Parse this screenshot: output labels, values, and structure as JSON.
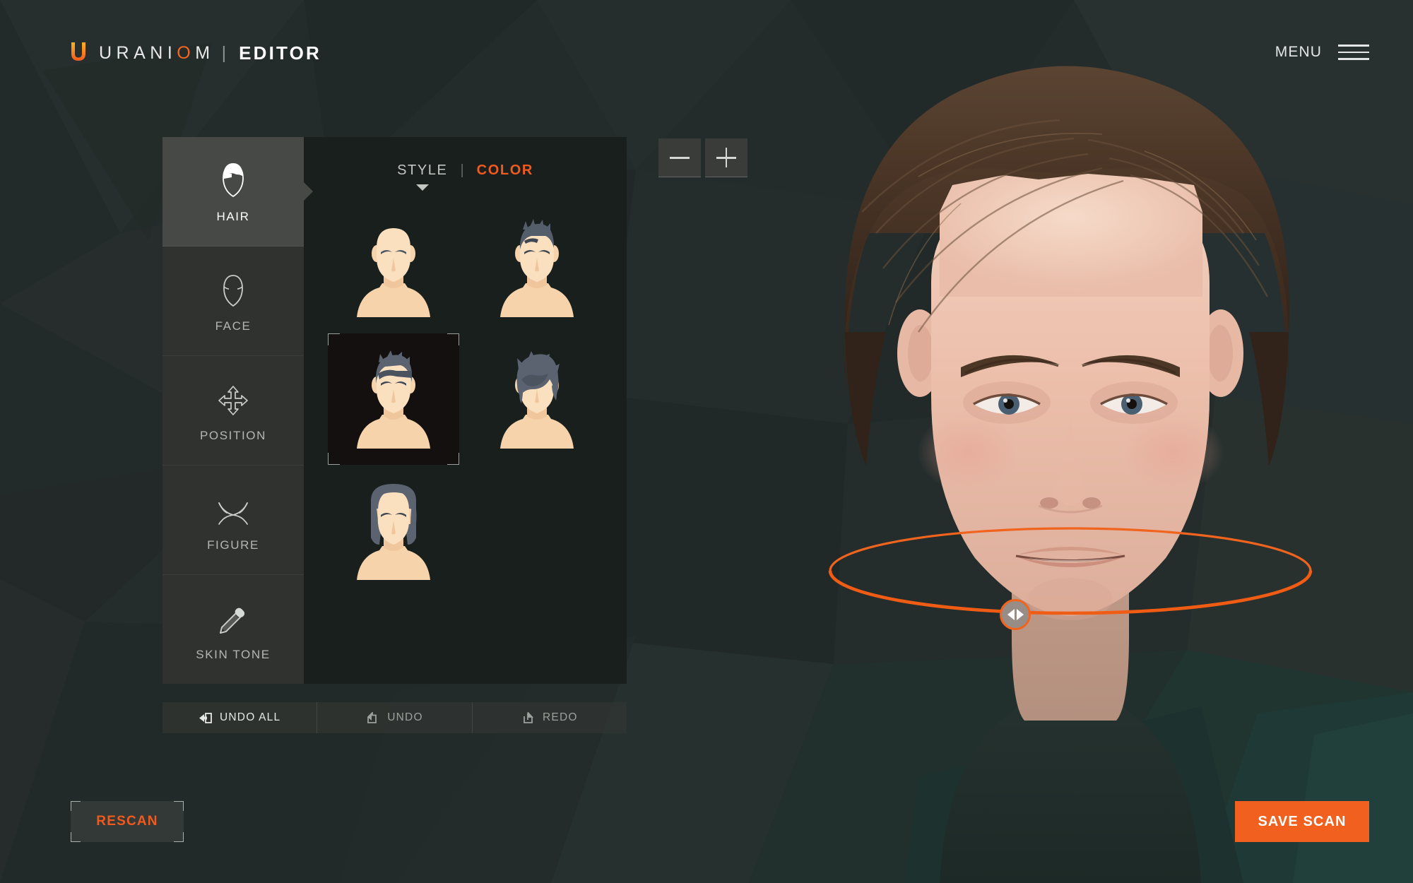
{
  "app": {
    "brand_u": "U",
    "brand_ur": "URANI",
    "brand_o": "O",
    "brand_m": "M",
    "brand_separator": "|",
    "brand_editor": "EDITOR",
    "accent_color": "#f15a1e",
    "panel_bg": "#343634",
    "background_color": "#242c2b"
  },
  "header": {
    "menu_label": "MENU",
    "menu_icon": "hamburger-icon"
  },
  "sidebar": {
    "items": [
      {
        "label": "HAIR",
        "icon": "hair-head-icon",
        "active": true
      },
      {
        "label": "FACE",
        "icon": "face-outline-icon",
        "active": false
      },
      {
        "label": "POSITION",
        "icon": "move-arrows-icon",
        "active": false
      },
      {
        "label": "FIGURE",
        "icon": "shoulders-icon",
        "active": false
      },
      {
        "label": "SKIN TONE",
        "icon": "eyedropper-icon",
        "active": false
      }
    ]
  },
  "options_panel": {
    "tabs": [
      {
        "label": "STYLE",
        "active": true,
        "has_caret": true
      },
      {
        "label": "COLOR",
        "active": false,
        "has_caret": false
      }
    ],
    "tab_divider": "|",
    "thumbnails": [
      {
        "name": "bald",
        "selected": false
      },
      {
        "name": "short-spiky",
        "selected": false
      },
      {
        "name": "short-sidepart",
        "selected": true
      },
      {
        "name": "messy-fringe",
        "selected": false
      },
      {
        "name": "medium-bob",
        "selected": false
      }
    ]
  },
  "history_bar": {
    "buttons": [
      {
        "label": "UNDO ALL",
        "icon": "undo-all-icon",
        "emphasis": true
      },
      {
        "label": "UNDO",
        "icon": "undo-icon",
        "emphasis": false
      },
      {
        "label": "REDO",
        "icon": "redo-icon",
        "emphasis": false
      }
    ]
  },
  "viewport": {
    "zoom_out_label": "−",
    "zoom_out_icon": "minus-icon",
    "zoom_in_label": "+",
    "zoom_in_icon": "plus-icon",
    "rotation_handle_icon": "rotate-left-right-icon",
    "rotation_ring_color": "#f1641e"
  },
  "footer": {
    "rescan_label": "RESCAN",
    "save_scan_label": "SAVE SCAN"
  }
}
